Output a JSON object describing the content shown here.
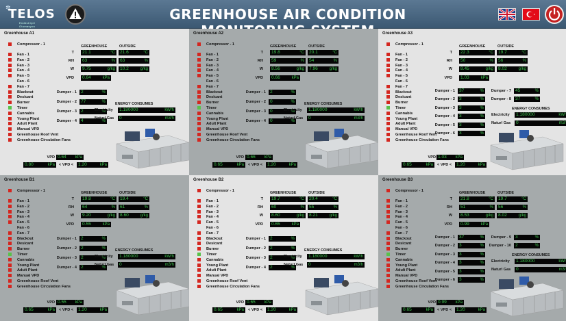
{
  "header": {
    "logo_text": "TELOS",
    "logo_subtitle": "Endüstriyel Otomasyon",
    "title": "GREENHOUSE AIR CONDITION MONITORING SYSTEM",
    "icons": [
      "warning-icon",
      "flag-uk-icon",
      "flag-tr-icon",
      "power-icon"
    ]
  },
  "labels": {
    "greenhouse_col": "GREENHOUSE",
    "outside_col": "OUTSIDE",
    "t": "T",
    "rh": "RH",
    "w": "W",
    "vpd": "VPD",
    "energy": "ENERGY CONSUMES",
    "electricity": "Electricity",
    "natural_gas": "Naturl Gas",
    "vpd_mid": "< VPD <"
  },
  "units": {
    "t": "°C",
    "rh": "%",
    "w": "g/kg",
    "vpd": "kPa",
    "pct": "%",
    "kwh": "kW/h",
    "m3h": "m3/h"
  },
  "items": [
    "Fan - 1",
    "Fan - 2",
    "Fan - 3",
    "Fan - 4",
    "Fan - 5",
    "Fan - 6",
    "Fan - 7",
    "Blackout",
    "Desicant",
    "Burner",
    "Timer",
    "Cannabis",
    "Young Plant",
    "Adult Plant",
    "Manual VPD",
    "Greenhouse Roof Vent",
    "Greenhouse Circulation Fans"
  ],
  "compressor": "Compressor - 1",
  "colors": {
    "active": "#58c24a",
    "inactive": "#d4261f",
    "readout": "#3ec24e"
  },
  "greenhouses": [
    {
      "name": "Greenhouse A1",
      "bg": "#e4e4e4",
      "gh": {
        "t": "21.1",
        "rh": "63",
        "w": "9.75"
      },
      "out": {
        "t": "21.6",
        "rh": "63",
        "w": "10.2"
      },
      "vpd": "0.64",
      "dampers": [
        {
          "label": "Dumper - 1",
          "value": "2"
        },
        {
          "label": "Dumper - 2",
          "value": "77"
        },
        {
          "label": "Dumper - 3",
          "value": "2"
        },
        {
          "label": "Dumper - 4",
          "value": "4"
        }
      ],
      "electricity": "1.180000",
      "gas": "0",
      "vpd_sp": "0.64",
      "vpd_min": "0.80",
      "vpd_max": "1.20"
    },
    {
      "name": "Greenhouse A2",
      "bg": "#a5aaab",
      "gh": {
        "t": "19.8",
        "rh": "59",
        "w": "8.56"
      },
      "out": {
        "t": "20.1",
        "rh": "54",
        "w": "7.96"
      },
      "vpd": "0.66",
      "dampers": [
        {
          "label": "Dumper - 1",
          "value": "2"
        },
        {
          "label": "Dumper - 2",
          "value": "0"
        },
        {
          "label": "Dumper - 3",
          "value": "0"
        },
        {
          "label": "Dumper - 4",
          "value": "0"
        }
      ],
      "electricity": "1.180000",
      "gas": "0",
      "vpd_sp": "0.66",
      "vpd_min": "0.65",
      "vpd_max": "1.20"
    },
    {
      "name": "Greenhouse A3",
      "bg": "#e4e4e4",
      "gh": {
        "t": "22.3",
        "rh": "50",
        "w": "8.45"
      },
      "out": {
        "t": "19.7",
        "rh": "56",
        "w": "8.02"
      },
      "vpd": "1.03",
      "dampers": [
        {
          "label": "Dumper - 1",
          "value": "37"
        },
        {
          "label": "Dumper - 2",
          "value": "3"
        },
        {
          "label": "Dumper - 3",
          "value": "3"
        },
        {
          "label": "Dumper - 4",
          "value": "3"
        },
        {
          "label": "Dumper - 5",
          "value": "3"
        },
        {
          "label": "Dumper - 6",
          "value": "3"
        }
      ],
      "extra": [
        {
          "label": "Dumper - 7",
          "value": "45"
        },
        {
          "label": "Dumper - 8",
          "value": "37"
        }
      ],
      "electricity": "1.180000",
      "gas": "0",
      "vpd_sp": "1.03",
      "vpd_min": "0.65",
      "vpd_max": "1.20"
    },
    {
      "name": "Greenhouse B1",
      "bg": "#a5aaab",
      "gh": {
        "t": "19.8",
        "rh": "64",
        "w": "9.20"
      },
      "out": {
        "t": "19.4",
        "rh": "61",
        "w": "8.60"
      },
      "vpd": "0.55",
      "dampers": [
        {
          "label": "Dumper - 1",
          "value": "2"
        },
        {
          "label": "Dumper - 2",
          "value": "2"
        },
        {
          "label": "Dumper - 3",
          "value": "2"
        },
        {
          "label": "Dumper - 4",
          "value": "2"
        }
      ],
      "electricity": "1.180000",
      "gas": "0",
      "vpd_sp": "0.55",
      "vpd_min": "0.65",
      "vpd_max": "1.20"
    },
    {
      "name": "Greenhouse B2",
      "bg": "#e4e4e4",
      "gh": {
        "t": "19.7",
        "rh": "60",
        "w": "8.60"
      },
      "out": {
        "t": "20.4",
        "rh": "55",
        "w": "8.21"
      },
      "vpd": "0.65",
      "dampers": [
        {
          "label": "Dumper - 1",
          "value": "2"
        },
        {
          "label": "Dumper - 2",
          "value": "2"
        },
        {
          "label": "Dumper - 3",
          "value": "2"
        },
        {
          "label": "Dumper - 4",
          "value": "2"
        }
      ],
      "electricity": "1.180000",
      "gas": "0",
      "vpd_sp": "0.65",
      "vpd_min": "0.65",
      "vpd_max": "1.20"
    },
    {
      "name": "Greenhouse B3",
      "bg": "#a5aaab",
      "gh": {
        "t": "21.8",
        "rh": "51",
        "w": "8.53"
      },
      "out": {
        "t": "19.7",
        "rh": "56",
        "w": "8.02"
      },
      "vpd": "0.99",
      "dampers": [
        {
          "label": "Dumper - 1",
          "value": "37"
        },
        {
          "label": "Dumper - 2",
          "value": "3"
        },
        {
          "label": "Dumper - 3",
          "value": "3"
        },
        {
          "label": "Dumper - 4",
          "value": "3"
        },
        {
          "label": "Dumper - 5",
          "value": "3"
        },
        {
          "label": "Dumper - 6",
          "value": "3"
        }
      ],
      "extra": [
        {
          "label": "Dumper - 9",
          "value": "3"
        },
        {
          "label": "Dumper - 10",
          "value": "2"
        }
      ],
      "electricity": "1.180000",
      "gas": "0",
      "vpd_sp": "0.99",
      "vpd_min": "0.65",
      "vpd_max": "1.20"
    }
  ],
  "status": {
    "A1": [
      1,
      1,
      1,
      1,
      1,
      0,
      1,
      1,
      1,
      1,
      2,
      1,
      1,
      1,
      1,
      1,
      1
    ],
    "A2": [
      1,
      1,
      1,
      1,
      1,
      0,
      1,
      1,
      1,
      1,
      2,
      1,
      1,
      1,
      1,
      1,
      1
    ],
    "A3": [
      1,
      1,
      1,
      1,
      1,
      0,
      1,
      1,
      1,
      1,
      2,
      1,
      1,
      1,
      1,
      1,
      1
    ],
    "B1": [
      1,
      1,
      1,
      1,
      1,
      0,
      1,
      1,
      1,
      1,
      2,
      1,
      1,
      1,
      1,
      1,
      1
    ],
    "B2": [
      1,
      1,
      1,
      1,
      1,
      0,
      1,
      1,
      1,
      1,
      2,
      1,
      1,
      1,
      1,
      1,
      1
    ],
    "B3": [
      1,
      1,
      1,
      1,
      1,
      0,
      1,
      1,
      1,
      1,
      2,
      1,
      1,
      1,
      1,
      1,
      1
    ]
  }
}
